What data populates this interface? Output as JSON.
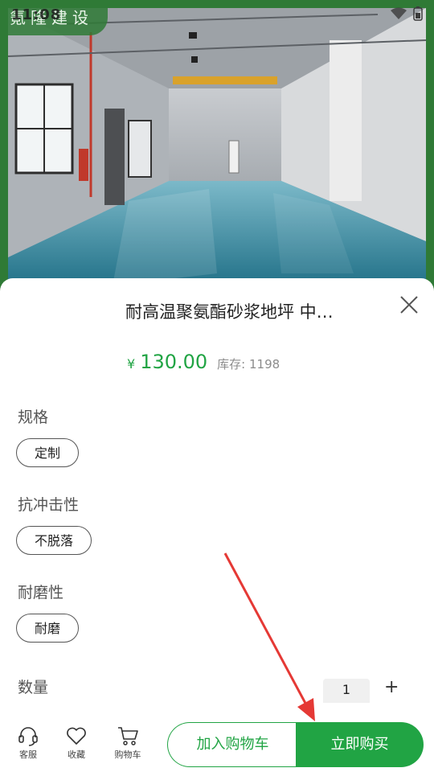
{
  "status_bar": {
    "time": "11:08"
  },
  "watermark": {
    "text": "氪隆建设"
  },
  "product": {
    "title": "耐高温聚氨酯砂浆地坪 中…",
    "currency_symbol": "¥",
    "price": "130.00",
    "stock": "库存: 1198"
  },
  "options": [
    {
      "label": "规格",
      "value": "定制"
    },
    {
      "label": "抗冲击性",
      "value": "不脱落"
    },
    {
      "label": "耐磨性",
      "value": "耐磨"
    }
  ],
  "quantity": {
    "label": "数量",
    "value": "1",
    "plus": "+"
  },
  "toolbar": {
    "service_label": "客服",
    "favorite_label": "收藏",
    "cart_label": "购物车",
    "add_to_cart": "加入购物车",
    "buy_now": "立即购买"
  },
  "colors": {
    "accent": "#21a444",
    "annotation_arrow": "#e53935"
  },
  "icons": [
    "headset-icon",
    "heart-icon",
    "shopping-cart-icon",
    "close-icon",
    "wifi-icon",
    "battery-icon"
  ]
}
